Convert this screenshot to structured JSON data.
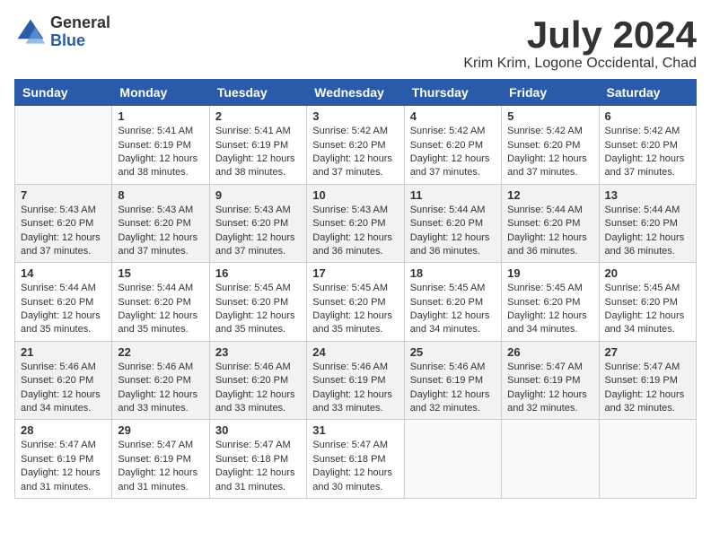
{
  "logo": {
    "general": "General",
    "blue": "Blue"
  },
  "title": "July 2024",
  "subtitle": "Krim Krim, Logone Occidental, Chad",
  "weekdays": [
    "Sunday",
    "Monday",
    "Tuesday",
    "Wednesday",
    "Thursday",
    "Friday",
    "Saturday"
  ],
  "weeks": [
    [
      {
        "day": "",
        "sunrise": "",
        "sunset": "",
        "daylight": ""
      },
      {
        "day": "1",
        "sunrise": "Sunrise: 5:41 AM",
        "sunset": "Sunset: 6:19 PM",
        "daylight": "Daylight: 12 hours and 38 minutes."
      },
      {
        "day": "2",
        "sunrise": "Sunrise: 5:41 AM",
        "sunset": "Sunset: 6:19 PM",
        "daylight": "Daylight: 12 hours and 38 minutes."
      },
      {
        "day": "3",
        "sunrise": "Sunrise: 5:42 AM",
        "sunset": "Sunset: 6:20 PM",
        "daylight": "Daylight: 12 hours and 37 minutes."
      },
      {
        "day": "4",
        "sunrise": "Sunrise: 5:42 AM",
        "sunset": "Sunset: 6:20 PM",
        "daylight": "Daylight: 12 hours and 37 minutes."
      },
      {
        "day": "5",
        "sunrise": "Sunrise: 5:42 AM",
        "sunset": "Sunset: 6:20 PM",
        "daylight": "Daylight: 12 hours and 37 minutes."
      },
      {
        "day": "6",
        "sunrise": "Sunrise: 5:42 AM",
        "sunset": "Sunset: 6:20 PM",
        "daylight": "Daylight: 12 hours and 37 minutes."
      }
    ],
    [
      {
        "day": "7",
        "sunrise": "Sunrise: 5:43 AM",
        "sunset": "Sunset: 6:20 PM",
        "daylight": "Daylight: 12 hours and 37 minutes."
      },
      {
        "day": "8",
        "sunrise": "Sunrise: 5:43 AM",
        "sunset": "Sunset: 6:20 PM",
        "daylight": "Daylight: 12 hours and 37 minutes."
      },
      {
        "day": "9",
        "sunrise": "Sunrise: 5:43 AM",
        "sunset": "Sunset: 6:20 PM",
        "daylight": "Daylight: 12 hours and 37 minutes."
      },
      {
        "day": "10",
        "sunrise": "Sunrise: 5:43 AM",
        "sunset": "Sunset: 6:20 PM",
        "daylight": "Daylight: 12 hours and 36 minutes."
      },
      {
        "day": "11",
        "sunrise": "Sunrise: 5:44 AM",
        "sunset": "Sunset: 6:20 PM",
        "daylight": "Daylight: 12 hours and 36 minutes."
      },
      {
        "day": "12",
        "sunrise": "Sunrise: 5:44 AM",
        "sunset": "Sunset: 6:20 PM",
        "daylight": "Daylight: 12 hours and 36 minutes."
      },
      {
        "day": "13",
        "sunrise": "Sunrise: 5:44 AM",
        "sunset": "Sunset: 6:20 PM",
        "daylight": "Daylight: 12 hours and 36 minutes."
      }
    ],
    [
      {
        "day": "14",
        "sunrise": "Sunrise: 5:44 AM",
        "sunset": "Sunset: 6:20 PM",
        "daylight": "Daylight: 12 hours and 35 minutes."
      },
      {
        "day": "15",
        "sunrise": "Sunrise: 5:44 AM",
        "sunset": "Sunset: 6:20 PM",
        "daylight": "Daylight: 12 hours and 35 minutes."
      },
      {
        "day": "16",
        "sunrise": "Sunrise: 5:45 AM",
        "sunset": "Sunset: 6:20 PM",
        "daylight": "Daylight: 12 hours and 35 minutes."
      },
      {
        "day": "17",
        "sunrise": "Sunrise: 5:45 AM",
        "sunset": "Sunset: 6:20 PM",
        "daylight": "Daylight: 12 hours and 35 minutes."
      },
      {
        "day": "18",
        "sunrise": "Sunrise: 5:45 AM",
        "sunset": "Sunset: 6:20 PM",
        "daylight": "Daylight: 12 hours and 34 minutes."
      },
      {
        "day": "19",
        "sunrise": "Sunrise: 5:45 AM",
        "sunset": "Sunset: 6:20 PM",
        "daylight": "Daylight: 12 hours and 34 minutes."
      },
      {
        "day": "20",
        "sunrise": "Sunrise: 5:45 AM",
        "sunset": "Sunset: 6:20 PM",
        "daylight": "Daylight: 12 hours and 34 minutes."
      }
    ],
    [
      {
        "day": "21",
        "sunrise": "Sunrise: 5:46 AM",
        "sunset": "Sunset: 6:20 PM",
        "daylight": "Daylight: 12 hours and 34 minutes."
      },
      {
        "day": "22",
        "sunrise": "Sunrise: 5:46 AM",
        "sunset": "Sunset: 6:20 PM",
        "daylight": "Daylight: 12 hours and 33 minutes."
      },
      {
        "day": "23",
        "sunrise": "Sunrise: 5:46 AM",
        "sunset": "Sunset: 6:20 PM",
        "daylight": "Daylight: 12 hours and 33 minutes."
      },
      {
        "day": "24",
        "sunrise": "Sunrise: 5:46 AM",
        "sunset": "Sunset: 6:19 PM",
        "daylight": "Daylight: 12 hours and 33 minutes."
      },
      {
        "day": "25",
        "sunrise": "Sunrise: 5:46 AM",
        "sunset": "Sunset: 6:19 PM",
        "daylight": "Daylight: 12 hours and 32 minutes."
      },
      {
        "day": "26",
        "sunrise": "Sunrise: 5:47 AM",
        "sunset": "Sunset: 6:19 PM",
        "daylight": "Daylight: 12 hours and 32 minutes."
      },
      {
        "day": "27",
        "sunrise": "Sunrise: 5:47 AM",
        "sunset": "Sunset: 6:19 PM",
        "daylight": "Daylight: 12 hours and 32 minutes."
      }
    ],
    [
      {
        "day": "28",
        "sunrise": "Sunrise: 5:47 AM",
        "sunset": "Sunset: 6:19 PM",
        "daylight": "Daylight: 12 hours and 31 minutes."
      },
      {
        "day": "29",
        "sunrise": "Sunrise: 5:47 AM",
        "sunset": "Sunset: 6:19 PM",
        "daylight": "Daylight: 12 hours and 31 minutes."
      },
      {
        "day": "30",
        "sunrise": "Sunrise: 5:47 AM",
        "sunset": "Sunset: 6:18 PM",
        "daylight": "Daylight: 12 hours and 31 minutes."
      },
      {
        "day": "31",
        "sunrise": "Sunrise: 5:47 AM",
        "sunset": "Sunset: 6:18 PM",
        "daylight": "Daylight: 12 hours and 30 minutes."
      },
      {
        "day": "",
        "sunrise": "",
        "sunset": "",
        "daylight": ""
      },
      {
        "day": "",
        "sunrise": "",
        "sunset": "",
        "daylight": ""
      },
      {
        "day": "",
        "sunrise": "",
        "sunset": "",
        "daylight": ""
      }
    ]
  ]
}
